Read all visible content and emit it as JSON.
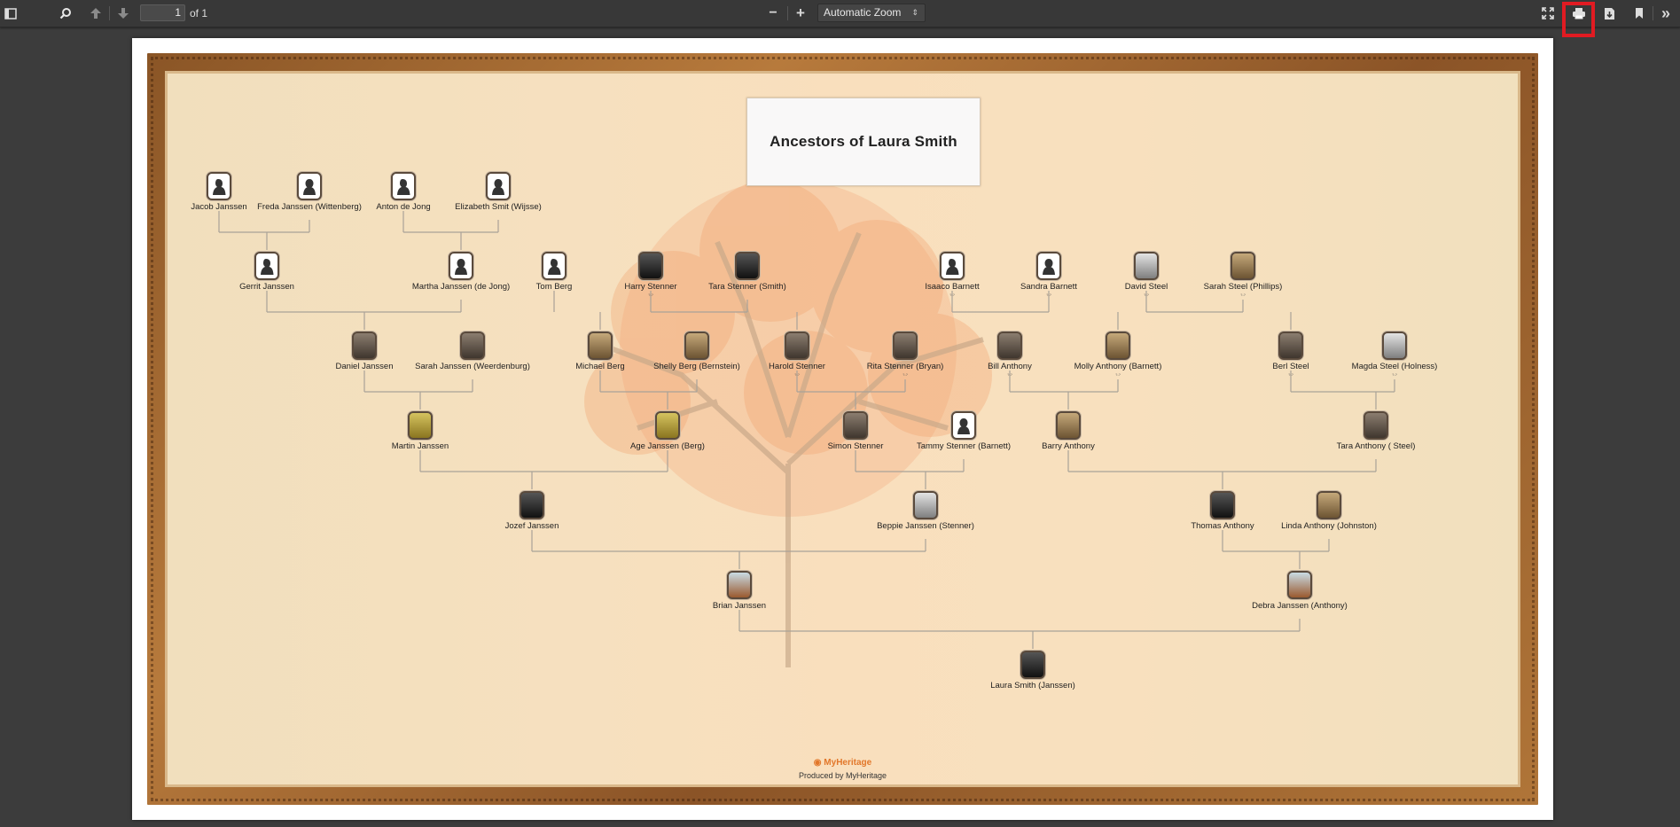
{
  "toolbar": {
    "page_number": "1",
    "page_total": "of 1",
    "zoom_label": "Automatic Zoom",
    "icons": {
      "sidebar": "sidebar-toggle-icon",
      "search": "search-icon",
      "prev": "arrow-up-icon",
      "next": "arrow-down-icon",
      "zoom_out": "minus-icon",
      "zoom_in": "plus-icon",
      "presentation": "fullscreen-icon",
      "print": "printer-icon",
      "download": "download-icon",
      "bookmark": "bookmark-icon",
      "tools": "double-chevron-right-icon"
    },
    "glyphs": {
      "zoom_out": "−",
      "zoom_in": "+",
      "tools": "»",
      "select_arrow": "⇕"
    },
    "highlight_color": "#e11b22"
  },
  "document": {
    "title": "Ancestors of Laura Smith",
    "logo": "MyHeritage",
    "footer": "Produced by MyHeritage",
    "people": [
      {
        "id": "jacob",
        "name": "Jacob Janssen",
        "dates": "",
        "portrait": "silhouette-male"
      },
      {
        "id": "freda",
        "name": "Freda Janssen (Wittenberg)",
        "dates": "",
        "portrait": "silhouette-female"
      },
      {
        "id": "anton",
        "name": "Anton de Jong",
        "dates": "",
        "portrait": "silhouette-male"
      },
      {
        "id": "elizabeth",
        "name": "Elizabeth Smit (Wijsse)",
        "dates": "",
        "portrait": "silhouette-female"
      },
      {
        "id": "gerrit",
        "name": "Gerrit Janssen",
        "dates": "",
        "portrait": "silhouette-male"
      },
      {
        "id": "martha",
        "name": "Martha Janssen (de Jong)",
        "dates": "",
        "portrait": "silhouette-female"
      },
      {
        "id": "tom",
        "name": "Tom Berg",
        "dates": "",
        "portrait": "silhouette-male"
      },
      {
        "id": "harry",
        "name": "Harry Stenner",
        "dates": "?-?",
        "portrait": "photo"
      },
      {
        "id": "tara_s",
        "name": "Tara Stenner (Smith)",
        "dates": "",
        "portrait": "photo"
      },
      {
        "id": "isaaco",
        "name": "Isaaco Barnett",
        "dates": "?-?",
        "portrait": "silhouette-male"
      },
      {
        "id": "sandra",
        "name": "Sandra Barnett",
        "dates": "?-?",
        "portrait": "silhouette-female"
      },
      {
        "id": "david",
        "name": "David Steel",
        "dates": "?-?",
        "portrait": "photo"
      },
      {
        "id": "sarah_p",
        "name": "Sarah Steel (Phillips)",
        "dates": "?-?",
        "portrait": "photo"
      },
      {
        "id": "daniel",
        "name": "Daniel Janssen",
        "dates": "",
        "portrait": "photo"
      },
      {
        "id": "sarah_w",
        "name": "Sarah Janssen (Weerdenburg)",
        "dates": "",
        "portrait": "photo"
      },
      {
        "id": "michael",
        "name": "Michael Berg",
        "dates": "",
        "portrait": "photo"
      },
      {
        "id": "shelly",
        "name": "Shelly Berg (Bernstein)",
        "dates": "",
        "portrait": "photo"
      },
      {
        "id": "harold",
        "name": "Harold Stenner",
        "dates": "?-?",
        "portrait": "photo"
      },
      {
        "id": "rita",
        "name": "Rita Stenner (Bryan)",
        "dates": "?-?",
        "portrait": "photo"
      },
      {
        "id": "bill",
        "name": "Bill Anthony",
        "dates": "?-?",
        "portrait": "photo"
      },
      {
        "id": "molly",
        "name": "Molly Anthony (Barnett)",
        "dates": "?-?",
        "portrait": "photo"
      },
      {
        "id": "berl",
        "name": "Berl Steel",
        "dates": "?-?",
        "portrait": "photo"
      },
      {
        "id": "magda",
        "name": "Magda Steel (Holness)",
        "dates": "?-?",
        "portrait": "photo"
      },
      {
        "id": "martin",
        "name": "Martin Janssen",
        "dates": "",
        "portrait": "photo"
      },
      {
        "id": "age",
        "name": "Age Janssen (Berg)",
        "dates": "",
        "portrait": "photo"
      },
      {
        "id": "simon",
        "name": "Simon Stenner",
        "dates": "",
        "portrait": "photo"
      },
      {
        "id": "tammy",
        "name": "Tammy Stenner (Barnett)",
        "dates": "",
        "portrait": "silhouette-female"
      },
      {
        "id": "barry",
        "name": "Barry Anthony",
        "dates": "",
        "portrait": "photo"
      },
      {
        "id": "tara_a",
        "name": "Tara Anthony ( Steel)",
        "dates": "",
        "portrait": "photo"
      },
      {
        "id": "jozef",
        "name": "Jozef Janssen",
        "dates": "",
        "portrait": "photo"
      },
      {
        "id": "beppie",
        "name": "Beppie Janssen (Stenner)",
        "dates": "",
        "portrait": "photo"
      },
      {
        "id": "thomas",
        "name": "Thomas Anthony",
        "dates": "",
        "portrait": "photo"
      },
      {
        "id": "linda",
        "name": "Linda Anthony (Johnston)",
        "dates": "",
        "portrait": "photo"
      },
      {
        "id": "brian",
        "name": "Brian Janssen",
        "dates": "",
        "portrait": "photo"
      },
      {
        "id": "debra",
        "name": "Debra Janssen (Anthony)",
        "dates": "",
        "portrait": "photo"
      },
      {
        "id": "laura",
        "name": "Laura Smith (Janssen)",
        "dates": "",
        "portrait": "photo"
      }
    ]
  }
}
